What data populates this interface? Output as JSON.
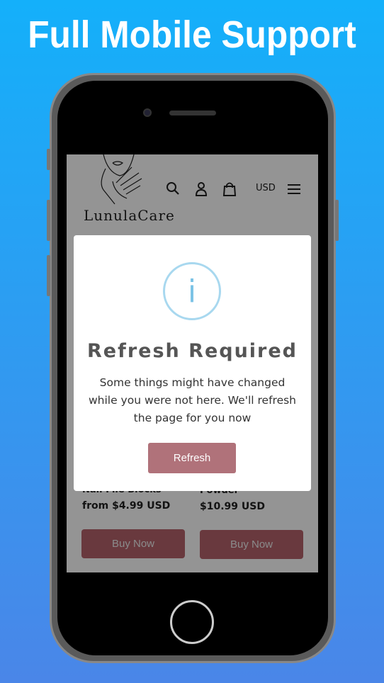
{
  "headline": "Full Mobile Support",
  "store": {
    "logo": "LunulaCare",
    "currency": "USD",
    "icons": [
      "search-icon",
      "account-icon",
      "cart-icon",
      "menu-icon"
    ]
  },
  "products": [
    {
      "name": "Nail File Blocks",
      "price": "from $4.99 USD",
      "button": "Buy Now"
    },
    {
      "name": "Powder",
      "price": "$10.99 USD",
      "button": "Buy Now"
    }
  ],
  "modal": {
    "icon": "info-icon",
    "icon_glyph": "i",
    "title": "Refresh Required",
    "message": "Some things might have changed while you were not here. We'll refresh the page for you now",
    "button": "Refresh"
  },
  "colors": {
    "background_top": "#14b0fa",
    "background_bottom": "#4a86e8",
    "buy_button": "#b5626c",
    "refresh_button": "#b0727a"
  }
}
